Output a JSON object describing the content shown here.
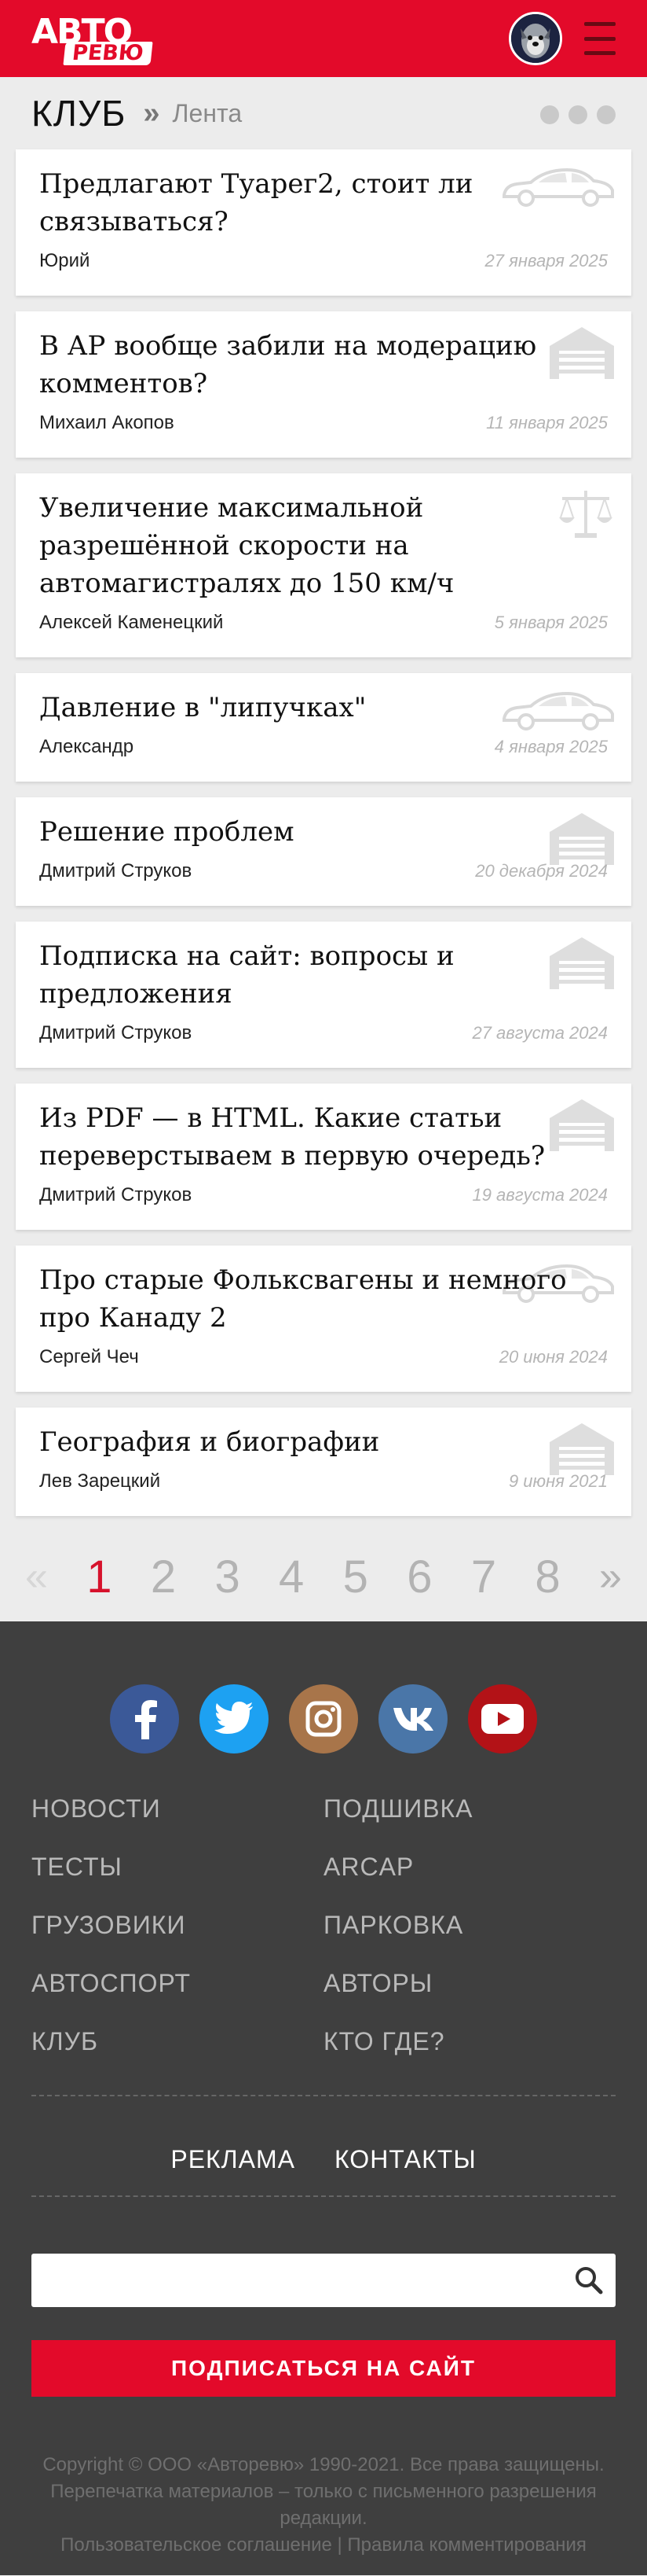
{
  "header": {
    "logo_top": "АВТО",
    "logo_bottom": "РЕВЮ",
    "colors": {
      "brand": "#e30a2a",
      "hamburger": "#6a0a14"
    }
  },
  "subheader": {
    "title": "КЛУБ",
    "separator": "»",
    "link": "Лента"
  },
  "topics": [
    {
      "title": "Предлагают Туарег2, стоит ли связываться?",
      "author": "Юрий",
      "date": "27 января 2025",
      "icon": "car-icon"
    },
    {
      "title": "В АР вообще забили на модерацию комментов?",
      "author": "Михаил Акопов",
      "date": "11 января 2025",
      "icon": "garage-icon"
    },
    {
      "title": "Увеличение максимальной разрешённой скорости на автомагистралях до 150 км/ч",
      "author": "Алексей Каменецкий",
      "date": "5 января 2025",
      "icon": "scales-icon"
    },
    {
      "title": "Давление в \"липучках\"",
      "author": "Александр",
      "date": "4 января 2025",
      "icon": "car-icon"
    },
    {
      "title": "Решение проблем",
      "author": "Дмитрий Струков",
      "date": "20 декабря 2024",
      "icon": "garage-icon"
    },
    {
      "title": "Подписка на сайт: вопросы и предложения",
      "author": "Дмитрий Струков",
      "date": "27 августа 2024",
      "icon": "garage-icon"
    },
    {
      "title": "Из PDF — в HTML. Какие статьи переверстываем в первую очередь?",
      "author": "Дмитрий Струков",
      "date": "19 августа 2024",
      "icon": "garage-icon"
    },
    {
      "title": "Про старые Фольксвагены и немного про Канаду 2",
      "author": "Сергей Чеч",
      "date": "20 июня 2024",
      "icon": "car-icon"
    },
    {
      "title": "География и биографии",
      "author": "Лев Зарецкий",
      "date": "9 июня 2021",
      "icon": "garage-icon"
    }
  ],
  "pagination": {
    "prev": "«",
    "pages": [
      "1",
      "2",
      "3",
      "4",
      "5",
      "6",
      "7",
      "8"
    ],
    "current": "1",
    "next": "»"
  },
  "footer": {
    "socials": [
      {
        "icon": "facebook-icon",
        "color": "#3b5998"
      },
      {
        "icon": "twitter-icon",
        "color": "#1da1f2"
      },
      {
        "icon": "instagram-icon",
        "color": "#a8754a"
      },
      {
        "icon": "vk-icon",
        "color": "#4a76a8"
      },
      {
        "icon": "youtube-icon",
        "color": "#b31217"
      }
    ],
    "menu": [
      "НОВОСТИ",
      "ПОДШИВКА",
      "ТЕСТЫ",
      "ARCAP",
      "ГРУЗОВИКИ",
      "ПАРКОВКА",
      "АВТОСПОРТ",
      "АВТОРЫ",
      "КЛУБ",
      "КТО ГДЕ?"
    ],
    "links": [
      "РЕКЛАМА",
      "КОНТАКТЫ"
    ],
    "search": {
      "placeholder": "",
      "value": ""
    },
    "subscribe_label": "ПОДПИСАТЬСЯ НА САЙТ",
    "copyright": "Copyright © ООО «Авторевю» 1990-2021. Все права защищены. Перепечатка материалов – только с письменного разрешения редакции.",
    "legal": {
      "agreement": "Пользовательское соглашение",
      "divider": "|",
      "rules": "Правила комментирования"
    }
  }
}
